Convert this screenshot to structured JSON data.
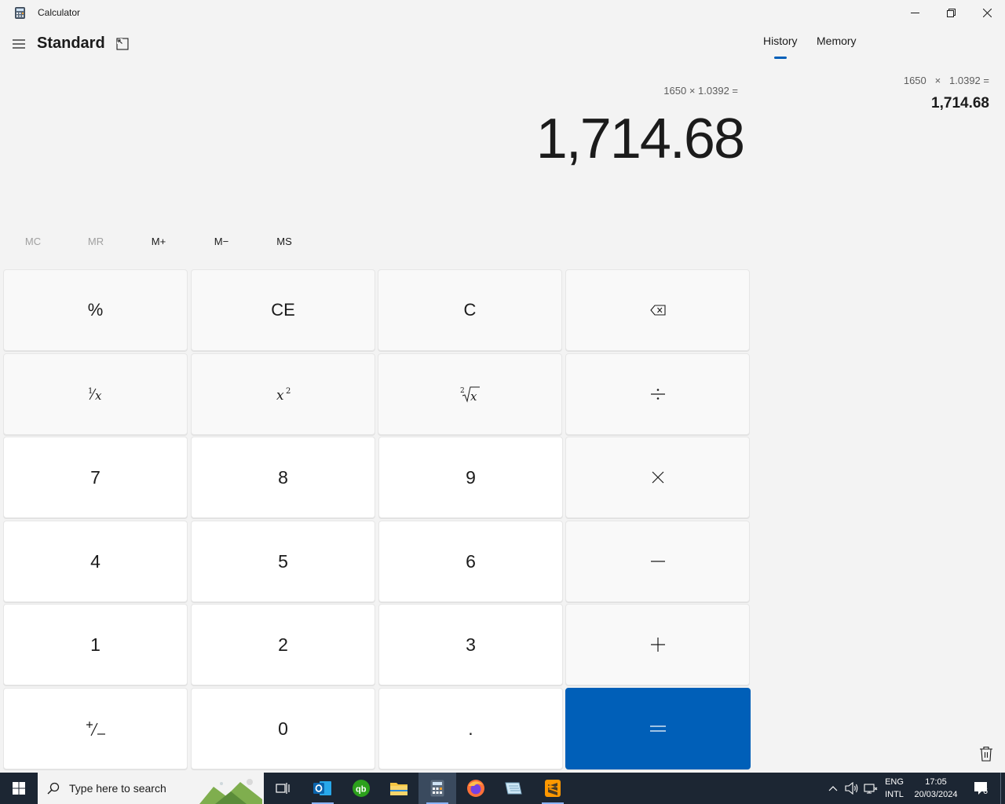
{
  "window": {
    "title": "Calculator"
  },
  "header": {
    "mode": "Standard"
  },
  "display": {
    "expression": "1650 × 1.0392 =",
    "value": "1,714.68"
  },
  "memory_buttons": [
    {
      "label": "MC",
      "enabled": false
    },
    {
      "label": "MR",
      "enabled": false
    },
    {
      "label": "M+",
      "enabled": true
    },
    {
      "label": "M−",
      "enabled": true
    },
    {
      "label": "MS",
      "enabled": true
    }
  ],
  "keys": {
    "percent": "%",
    "ce": "CE",
    "c": "C",
    "seven": "7",
    "eight": "8",
    "nine": "9",
    "four": "4",
    "five": "5",
    "six": "6",
    "one": "1",
    "two": "2",
    "three": "3",
    "zero": "0",
    "decimal": "."
  },
  "side_panel": {
    "tabs": [
      {
        "label": "History",
        "active": true
      },
      {
        "label": "Memory",
        "active": false
      }
    ],
    "history": [
      {
        "expression": "1650   ×   1.0392 =",
        "result": "1,714.68"
      }
    ]
  },
  "taskbar": {
    "search_placeholder": "Type here to search",
    "language": "ENG",
    "layout": "INTL",
    "time": "17:05",
    "date": "20/03/2024",
    "notification_count": "6",
    "pinned": [
      "outlook-icon",
      "quickbooks-icon",
      "file-explorer-icon",
      "calculator-icon",
      "firefox-icon",
      "notepad-icon",
      "sublime-text-icon"
    ]
  },
  "colors": {
    "accent": "#005fb8",
    "background": "#f3f3f3",
    "taskbar": "#1c2633"
  }
}
